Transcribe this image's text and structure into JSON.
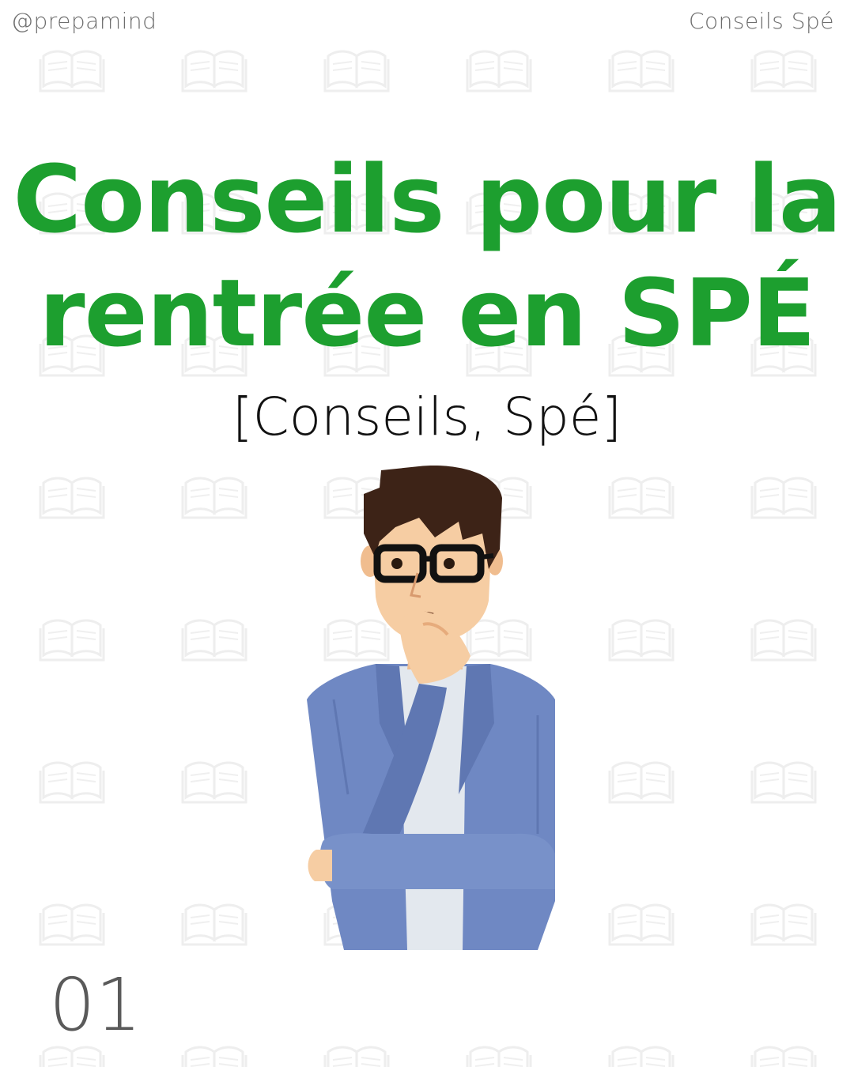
{
  "header": {
    "handle": "@prepamind",
    "series": "Conseils Spé"
  },
  "title": {
    "line1": "Conseils pour la",
    "line2": "rentrée en SPÉ"
  },
  "tags": "[Conseils, Spé]",
  "page_number": "01",
  "colors": {
    "accent": "#1d9f2f",
    "pattern": "#eeeeee",
    "text_muted": "#6e6e6e",
    "jacket": "#6f88c3",
    "hair": "#3d2317",
    "skin": "#f6cda3",
    "shirt": "#e3e8ee"
  },
  "icons": {
    "background": "open-book-icon",
    "figure": "thinking-man-illustration"
  }
}
